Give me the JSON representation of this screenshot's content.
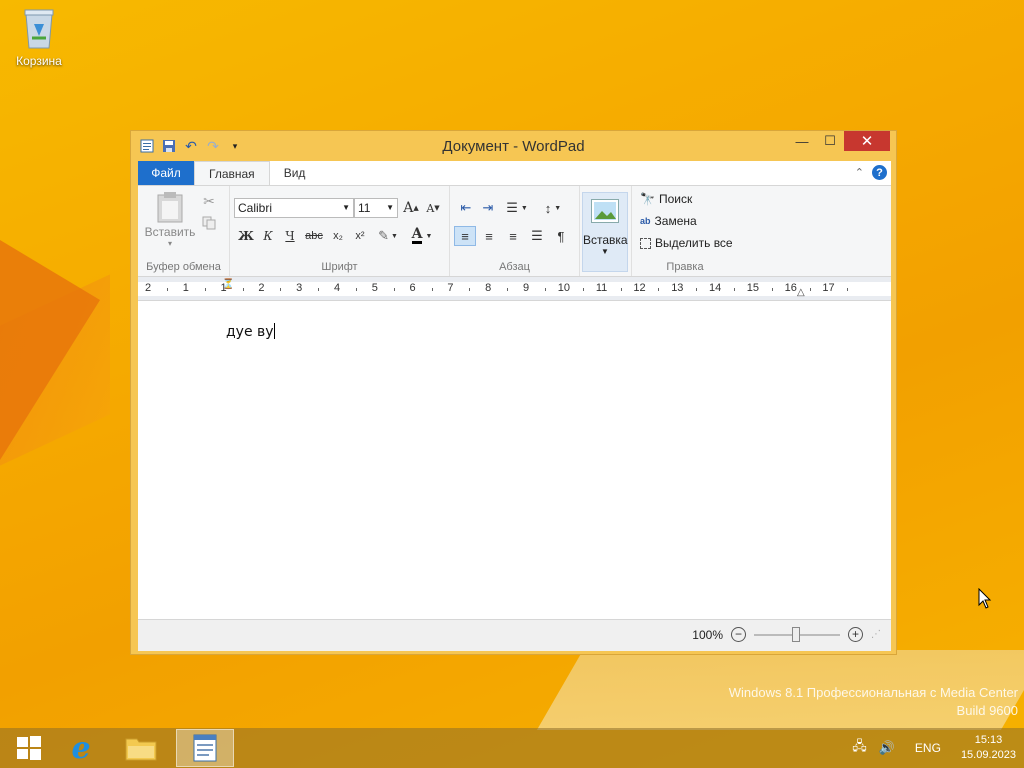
{
  "desktop": {
    "recycle_bin_label": "Корзина",
    "watermark_line1": "Windows 8.1 Профессиональная с Media Center",
    "watermark_line2": "Build 9600"
  },
  "window": {
    "title": "Документ - WordPad",
    "tabs": {
      "file": "Файл",
      "home": "Главная",
      "view": "Вид"
    },
    "ribbon": {
      "clipboard": {
        "paste": "Вставить",
        "group": "Буфер обмена"
      },
      "font": {
        "name": "Calibri",
        "size": "11",
        "group": "Шрифт",
        "bold": "Ж",
        "italic": "К",
        "underline": "Ч",
        "strike": "abc",
        "subscript": "x₂",
        "superscript": "x²",
        "grow": "A",
        "shrink": "A",
        "color_letter": "A"
      },
      "paragraph": {
        "group": "Абзац"
      },
      "insert": {
        "label": "Вставка"
      },
      "editing": {
        "find": "Поиск",
        "replace": "Замена",
        "select_all": "Выделить все",
        "group": "Правка"
      }
    },
    "ruler": {
      "numbers": [
        "2",
        "1",
        "1",
        "2",
        "3",
        "4",
        "5",
        "6",
        "7",
        "8",
        "9",
        "10",
        "11",
        "12",
        "13",
        "14",
        "15",
        "16",
        "17"
      ]
    },
    "document": {
      "text": "дуе ву"
    },
    "status": {
      "zoom": "100%"
    }
  },
  "taskbar": {
    "language": "ENG",
    "time": "15:13",
    "date": "15.09.2023"
  },
  "colors": {
    "accent": "#1e6fcc",
    "close": "#c7372f",
    "window_frame": "#f6c653"
  }
}
